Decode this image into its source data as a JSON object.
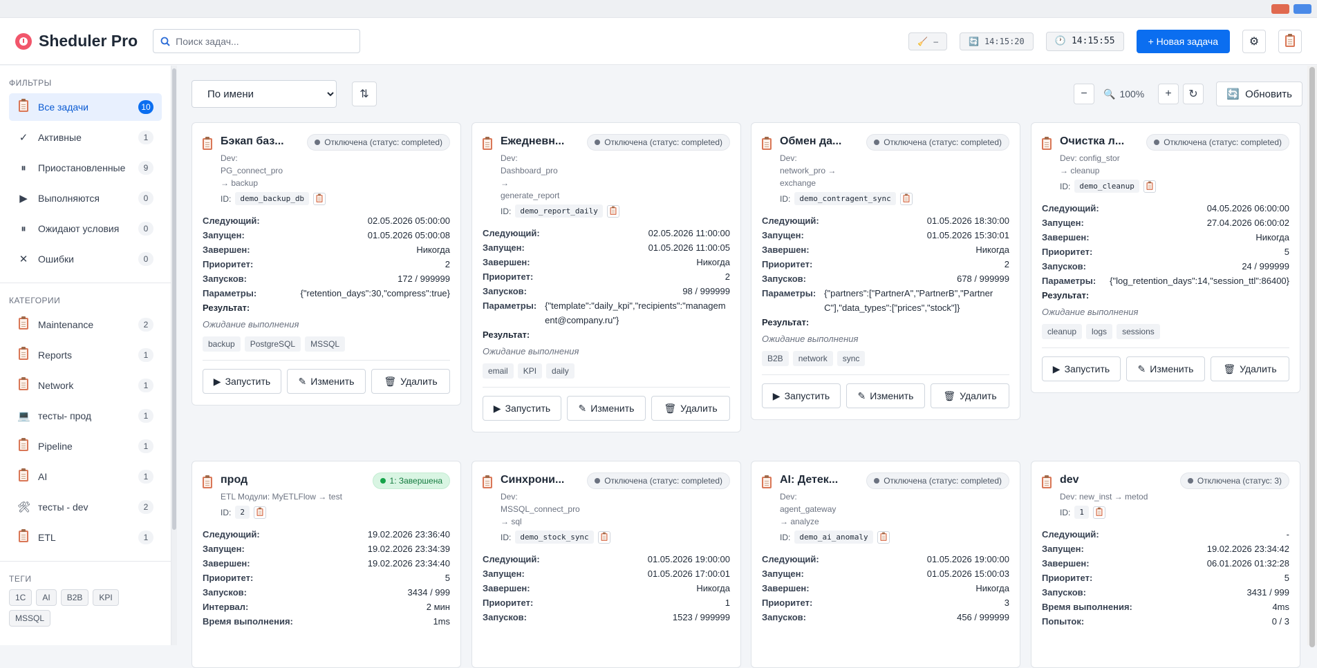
{
  "app": {
    "title": "Sheduler Pro"
  },
  "header": {
    "search_placeholder": "Поиск задач...",
    "status_pill": "–",
    "last_refresh": "14:15:20",
    "clock": "14:15:55",
    "new_task_label": "+ Новая задача"
  },
  "sidebar": {
    "filters_title": "ФИЛЬТРЫ",
    "filters": [
      {
        "label": "Все задачи",
        "count": "10",
        "icon": "clipboard-icon"
      },
      {
        "label": "Активные",
        "count": "1",
        "icon": "check-icon"
      },
      {
        "label": "Приостановленные",
        "count": "9",
        "icon": "pause-icon"
      },
      {
        "label": "Выполняются",
        "count": "0",
        "icon": "play-icon"
      },
      {
        "label": "Ожидают условия",
        "count": "0",
        "icon": "pause-icon"
      },
      {
        "label": "Ошибки",
        "count": "0",
        "icon": "cross-icon"
      }
    ],
    "categories_title": "КАТЕГОРИИ",
    "categories": [
      {
        "label": "Maintenance",
        "count": "2"
      },
      {
        "label": "Reports",
        "count": "1"
      },
      {
        "label": "Network",
        "count": "1"
      },
      {
        "label": "тесты- прод",
        "count": "1"
      },
      {
        "label": "Pipeline",
        "count": "1"
      },
      {
        "label": "AI",
        "count": "1"
      },
      {
        "label": "тесты - dev",
        "count": "2"
      },
      {
        "label": "ETL",
        "count": "1"
      }
    ],
    "tags_title": "ТЕГИ",
    "tags": [
      "1C",
      "AI",
      "B2B",
      "KPI",
      "MSSQL"
    ]
  },
  "toolbar": {
    "sort_selected": "По имени",
    "zoom": "100%",
    "refresh_label": "Обновить"
  },
  "labels": {
    "next": "Следующий:",
    "started": "Запущен:",
    "finished": "Завершен:",
    "priority": "Приоритет:",
    "runs": "Запусков:",
    "params": "Параметры:",
    "result": "Результат:",
    "interval": "Интервал:",
    "exec_time": "Время выполнения:",
    "attempts": "Попыток:",
    "waiting": "Ожидание выполнения",
    "run": "Запустить",
    "edit": "Изменить",
    "delete": "Удалить",
    "id": "ID:"
  },
  "cards": [
    {
      "title": "Бэкап баз...",
      "status": "Отключена (статус: completed)",
      "sub": [
        "Dev:",
        "PG_connect_pro",
        "→ backup"
      ],
      "id": "demo_backup_db",
      "next": "02.05.2026 05:00:00",
      "started": "01.05.2026 05:00:08",
      "finished": "Никогда",
      "priority": "2",
      "runs": "172 / 999999",
      "params": "{\"retention_days\":30,\"compress\":true}",
      "tags": [
        "backup",
        "PostgreSQL",
        "MSSQL"
      ]
    },
    {
      "title": "Ежедневн...",
      "status": "Отключена (статус: completed)",
      "sub": [
        "Dev:",
        "Dashboard_pro",
        "→",
        "generate_report"
      ],
      "id": "demo_report_daily",
      "next": "02.05.2026 11:00:00",
      "started": "01.05.2026 11:00:05",
      "finished": "Никогда",
      "priority": "2",
      "runs": "98 / 999999",
      "params": "{\"template\":\"daily_kpi\",\"recipients\":\"management@company.ru\"}",
      "tags": [
        "email",
        "KPI",
        "daily"
      ]
    },
    {
      "title": "Обмен да...",
      "status": "Отключена (статус: completed)",
      "sub": [
        "Dev:",
        "network_pro →",
        "exchange"
      ],
      "id": "demo_contragent_sync",
      "next": "01.05.2026 18:30:00",
      "started": "01.05.2026 15:30:01",
      "finished": "Никогда",
      "priority": "2",
      "runs": "678 / 999999",
      "params": "{\"partners\":[\"PartnerA\",\"PartnerB\",\"PartnerC\"],\"data_types\":[\"prices\",\"stock\"]}",
      "tags": [
        "B2B",
        "network",
        "sync"
      ]
    },
    {
      "title": "Очистка л...",
      "status": "Отключена (статус: completed)",
      "sub": [
        "Dev: config_stor",
        "→ cleanup"
      ],
      "id": "demo_cleanup",
      "next": "04.05.2026 06:00:00",
      "started": "27.04.2026 06:00:02",
      "finished": "Никогда",
      "priority": "5",
      "runs": "24 / 999999",
      "params": "{\"log_retention_days\":14,\"session_ttl\":86400}",
      "tags": [
        "cleanup",
        "logs",
        "sessions"
      ]
    },
    {
      "title": "прод",
      "status": "1: Завершена",
      "sub": [
        "ETL Модули: MyETLFlow → test"
      ],
      "id": "2",
      "next": "19.02.2026 23:36:40",
      "started": "19.02.2026 23:34:39",
      "finished": "19.02.2026 23:34:40",
      "priority": "5",
      "runs": "3434 / 999",
      "interval": "2 мин",
      "exec_time": "1ms"
    },
    {
      "title": "Синхрони...",
      "status": "Отключена (статус: completed)",
      "sub": [
        "Dev:",
        "MSSQL_connect_pro",
        "→ sql"
      ],
      "id": "demo_stock_sync",
      "next": "01.05.2026 19:00:00",
      "started": "01.05.2026 17:00:01",
      "finished": "Никогда",
      "priority": "1",
      "runs": "1523 / 999999"
    },
    {
      "title": "AI: Детек...",
      "status": "Отключена (статус: completed)",
      "sub": [
        "Dev:",
        "agent_gateway",
        "→ analyze"
      ],
      "id": "demo_ai_anomaly",
      "next": "01.05.2026 19:00:00",
      "started": "01.05.2026 15:00:03",
      "finished": "Никогда",
      "priority": "3",
      "runs": "456 / 999999"
    },
    {
      "title": "dev",
      "status": "Отключена (статус: 3)",
      "sub": [
        "Dev: new_inst → metod"
      ],
      "id": "1",
      "next": "-",
      "started": "19.02.2026 23:34:42",
      "finished": "06.01.2026 01:32:28",
      "priority": "5",
      "runs": "3431 / 999",
      "exec_time": "4ms",
      "attempts": "0 / 3"
    }
  ],
  "colors": {
    "accent": "#0b6ef0",
    "active_bg": "#e8f0fe",
    "success": "#16a34a"
  }
}
